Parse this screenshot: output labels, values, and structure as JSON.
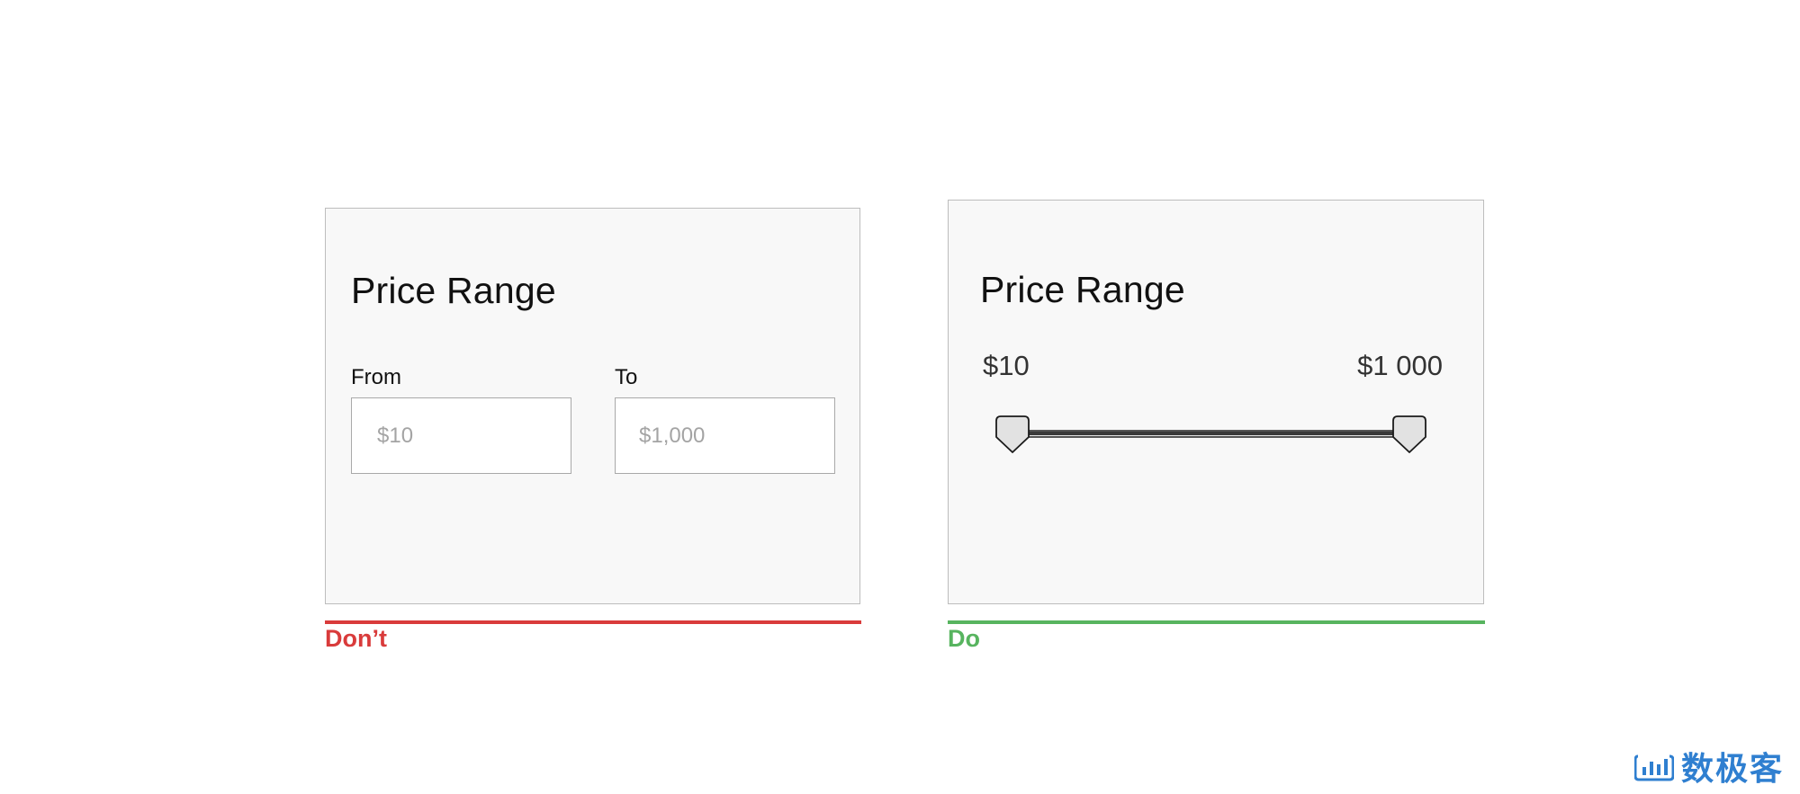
{
  "dont_example": {
    "title": "Price Range",
    "from_label": "From",
    "to_label": "To",
    "from_placeholder": "$10",
    "to_placeholder": "$1,000",
    "caption": "Don’t",
    "accent_color": "#d93b3b"
  },
  "do_example": {
    "title": "Price Range",
    "min_label": "$10",
    "max_label": "$1 000",
    "slider_min_fraction": 0,
    "slider_max_fraction": 1,
    "caption": "Do",
    "accent_color": "#57b45f"
  },
  "icons": {
    "slider_handle": "slider-handle-icon",
    "watermark_logo": "chart-bars-logo-icon"
  },
  "watermark": {
    "text": "数极客"
  }
}
